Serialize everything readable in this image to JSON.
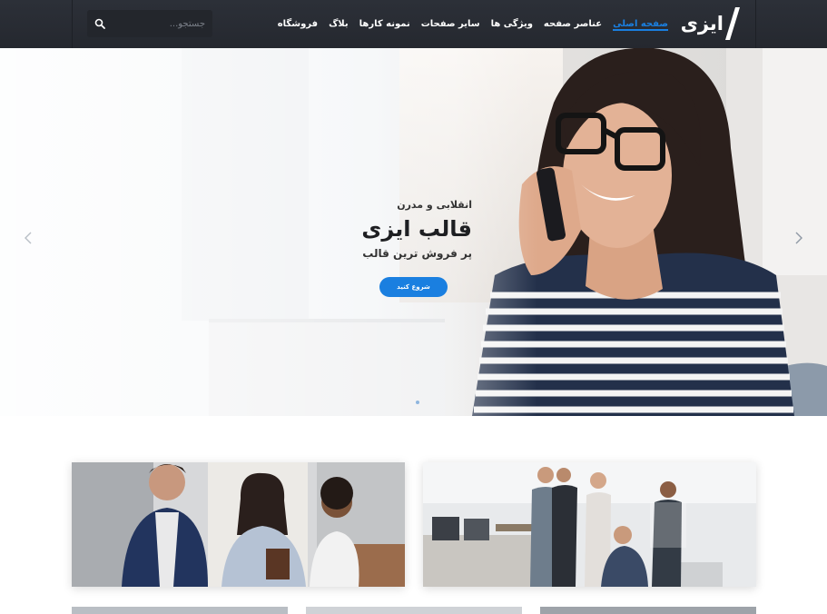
{
  "header": {
    "logo_text": "ایزی",
    "nav": [
      {
        "label": "صفحه اصلی",
        "active": true
      },
      {
        "label": "عناصر صفحه",
        "active": false
      },
      {
        "label": "ویژگی ها",
        "active": false
      },
      {
        "label": "سایر صفحات",
        "active": false
      },
      {
        "label": "نمونه کارها",
        "active": false
      },
      {
        "label": "بلاگ",
        "active": false
      },
      {
        "label": "فروشگاه",
        "active": false
      }
    ],
    "search": {
      "placeholder": "جستجو..."
    }
  },
  "hero": {
    "kicker": "انقلابی و مدرن",
    "title": "قالب ایزی",
    "subtitle": "پر فروش ترین قالب",
    "cta_label": "شروع کنید"
  },
  "colors": {
    "header_bg": "#2a2d34",
    "accent": "#1a7fe0",
    "hero_bg": "#e9edf2"
  },
  "icons": {
    "search": "search-icon",
    "prev": "chevron-left-icon",
    "next": "chevron-right-icon",
    "logo": "slash-logo-icon"
  }
}
